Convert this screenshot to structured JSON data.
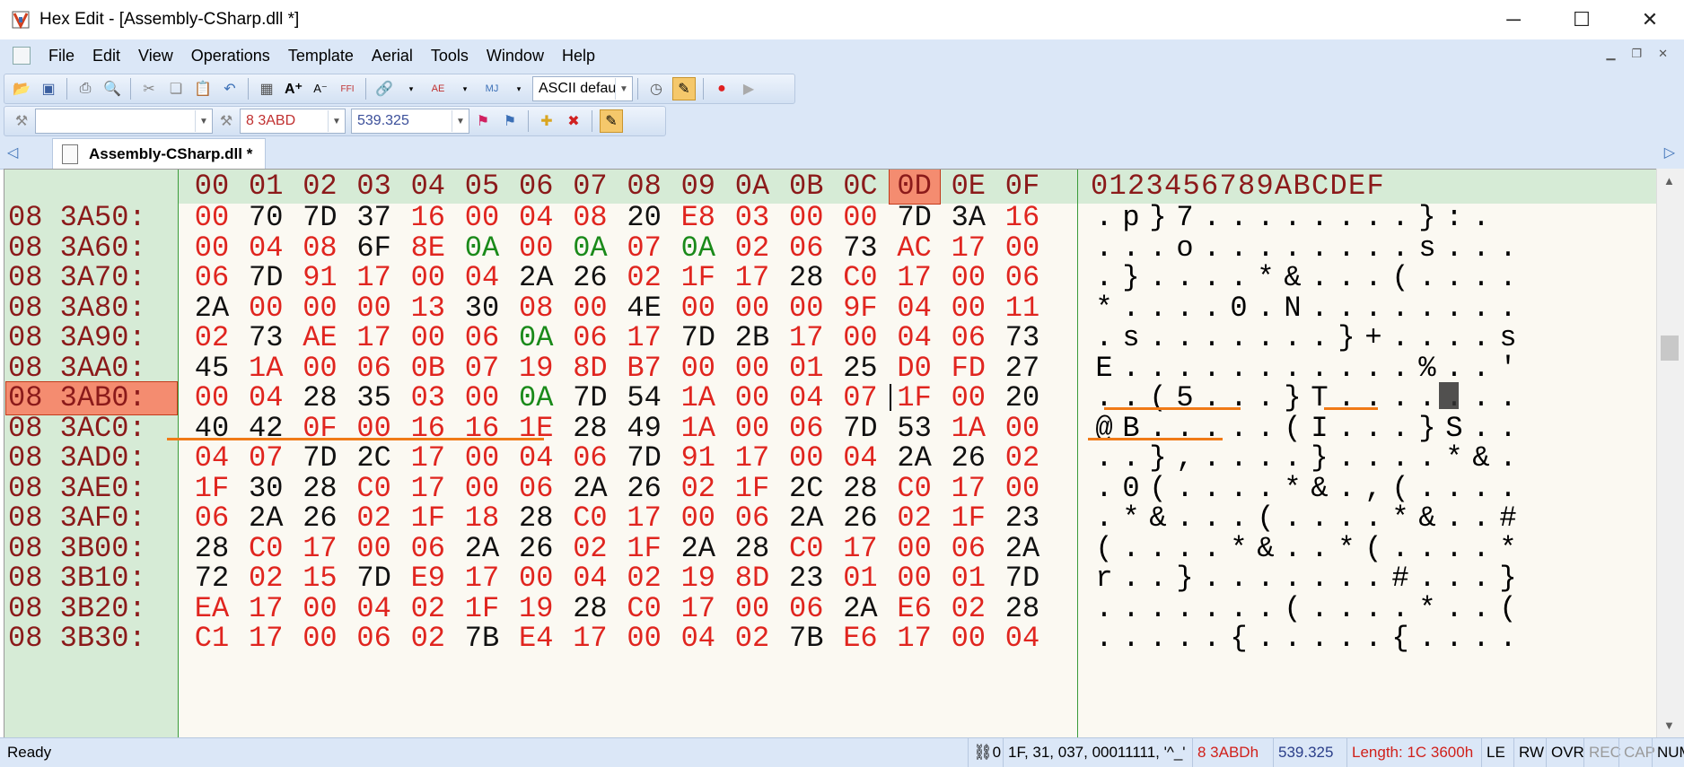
{
  "window": {
    "title": "Hex Edit - [Assembly-CSharp.dll *]",
    "minimize": "─",
    "maximize": "☐",
    "close": "✕"
  },
  "menu": {
    "items": [
      {
        "label": "File"
      },
      {
        "label": "Edit"
      },
      {
        "label": "View"
      },
      {
        "label": "Operations"
      },
      {
        "label": "Template"
      },
      {
        "label": "Aerial"
      },
      {
        "label": "Tools"
      },
      {
        "label": "Window"
      },
      {
        "label": "Help"
      }
    ]
  },
  "toolbar": {
    "charset": "ASCII defau",
    "search_value": "",
    "address": "8 3ABD",
    "decimal_address": "539.325"
  },
  "tab": {
    "label": "Assembly-CSharp.dll *"
  },
  "editor": {
    "hex_header": [
      "00",
      "01",
      "02",
      "03",
      "04",
      "05",
      "06",
      "07",
      "08",
      "09",
      "0A",
      "0B",
      "0C",
      "0D",
      "0E",
      "0F"
    ],
    "ascii_header": "0123456789ABCDEF",
    "highlight_col": "0D",
    "rows": [
      {
        "addr": "08 3A50:",
        "hex": [
          "00",
          "70",
          "7D",
          "37",
          "16",
          "00",
          "04",
          "08",
          "20",
          "E8",
          "03",
          "00",
          "00",
          "7D",
          "3A",
          "16"
        ],
        "ascii": ".p}7........}:."
      },
      {
        "addr": "08 3A60:",
        "hex": [
          "00",
          "04",
          "08",
          "6F",
          "8E",
          "0A",
          "00",
          "0A",
          "07",
          "0A",
          "02",
          "06",
          "73",
          "AC",
          "17",
          "00"
        ],
        "ascii": "...o........s..."
      },
      {
        "addr": "08 3A70:",
        "hex": [
          "06",
          "7D",
          "91",
          "17",
          "00",
          "04",
          "2A",
          "26",
          "02",
          "1F",
          "17",
          "28",
          "C0",
          "17",
          "00",
          "06"
        ],
        "ascii": ".}....*&...(...."
      },
      {
        "addr": "08 3A80:",
        "hex": [
          "2A",
          "00",
          "00",
          "00",
          "13",
          "30",
          "08",
          "00",
          "4E",
          "00",
          "00",
          "00",
          "9F",
          "04",
          "00",
          "11"
        ],
        "ascii": "*....0.N........"
      },
      {
        "addr": "08 3A90:",
        "hex": [
          "02",
          "73",
          "AE",
          "17",
          "00",
          "06",
          "0A",
          "06",
          "17",
          "7D",
          "2B",
          "17",
          "00",
          "04",
          "06",
          "73"
        ],
        "ascii": ".s.......}+....s"
      },
      {
        "addr": "08 3AA0:",
        "hex": [
          "45",
          "1A",
          "00",
          "06",
          "0B",
          "07",
          "19",
          "8D",
          "B7",
          "00",
          "00",
          "01",
          "25",
          "D0",
          "FD",
          "27"
        ],
        "ascii": "E...........%..'"
      },
      {
        "addr": "08 3AB0:",
        "hex": [
          "00",
          "04",
          "28",
          "35",
          "03",
          "00",
          "0A",
          "7D",
          "54",
          "1A",
          "00",
          "04",
          "07",
          "1F",
          "00",
          "20"
        ],
        "ascii": "..(5...}T......."
      },
      {
        "addr": "08 3AC0:",
        "hex": [
          "40",
          "42",
          "0F",
          "00",
          "16",
          "16",
          "1E",
          "28",
          "49",
          "1A",
          "00",
          "06",
          "7D",
          "53",
          "1A",
          "00"
        ],
        "ascii": "@B.....(I...}S.."
      },
      {
        "addr": "08 3AD0:",
        "hex": [
          "04",
          "07",
          "7D",
          "2C",
          "17",
          "00",
          "04",
          "06",
          "7D",
          "91",
          "17",
          "00",
          "04",
          "2A",
          "26",
          "02"
        ],
        "ascii": "..},....}....*&."
      },
      {
        "addr": "08 3AE0:",
        "hex": [
          "1F",
          "30",
          "28",
          "C0",
          "17",
          "00",
          "06",
          "2A",
          "26",
          "02",
          "1F",
          "2C",
          "28",
          "C0",
          "17",
          "00"
        ],
        "ascii": ".0(....*&.,(...."
      },
      {
        "addr": "08 3AF0:",
        "hex": [
          "06",
          "2A",
          "26",
          "02",
          "1F",
          "18",
          "28",
          "C0",
          "17",
          "00",
          "06",
          "2A",
          "26",
          "02",
          "1F",
          "23"
        ],
        "ascii": ".*&...(....*&..#"
      },
      {
        "addr": "08 3B00:",
        "hex": [
          "28",
          "C0",
          "17",
          "00",
          "06",
          "2A",
          "26",
          "02",
          "1F",
          "2A",
          "28",
          "C0",
          "17",
          "00",
          "06",
          "2A"
        ],
        "ascii": "(....*&..*(....*"
      },
      {
        "addr": "08 3B10:",
        "hex": [
          "72",
          "02",
          "15",
          "7D",
          "E9",
          "17",
          "00",
          "04",
          "02",
          "19",
          "8D",
          "23",
          "01",
          "00",
          "01",
          "7D"
        ],
        "ascii": "r..}.......#...}"
      },
      {
        "addr": "08 3B20:",
        "hex": [
          "EA",
          "17",
          "00",
          "04",
          "02",
          "1F",
          "19",
          "28",
          "C0",
          "17",
          "00",
          "06",
          "2A",
          "E6",
          "02",
          "28"
        ],
        "ascii": ".......(....*..("
      },
      {
        "addr": "08 3B30:",
        "hex": [
          "C1",
          "17",
          "00",
          "06",
          "02",
          "7B",
          "E4",
          "17",
          "00",
          "04",
          "02",
          "7B",
          "E6",
          "17",
          "00",
          "04"
        ],
        "ascii": ".....{.....{...."
      }
    ]
  },
  "status": {
    "ready": "Ready",
    "marker": "⛓0",
    "char_info": "1F, 31, 037, 00011111, '^_'",
    "hex_addr": "8 3ABDh",
    "dec_addr": "539.325",
    "length": "Length: 1C 3600h",
    "endian": "LE",
    "rw": "RW",
    "ovr": "OVR",
    "rec": "REC",
    "cap": "CAP",
    "num": "NUM"
  }
}
